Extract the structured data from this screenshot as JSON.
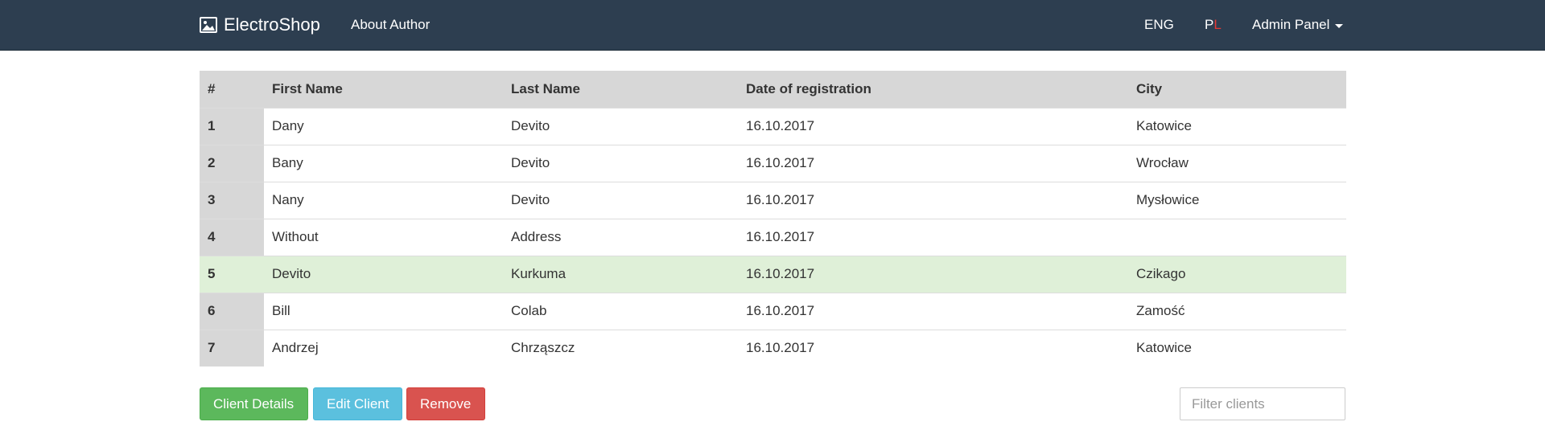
{
  "navbar": {
    "brand": "ElectroShop",
    "brand_icon": "image-icon",
    "about": "About Author",
    "lang_eng": "ENG",
    "lang_pl_p": "P",
    "lang_pl_l": "L",
    "admin": "Admin Panel",
    "bg_color": "#2d3e50",
    "accent_color": "#e53935"
  },
  "table": {
    "headers": [
      "#",
      "First Name",
      "Last Name",
      "Date of registration",
      "City"
    ],
    "rows": [
      [
        "1",
        "Dany",
        "Devito",
        "16.10.2017",
        "Katowice"
      ],
      [
        "2",
        "Bany",
        "Devito",
        "16.10.2017",
        "Wrocław"
      ],
      [
        "3",
        "Nany",
        "Devito",
        "16.10.2017",
        "Mysłowice"
      ],
      [
        "4",
        "Without",
        "Address",
        "16.10.2017",
        ""
      ],
      [
        "5",
        "Devito",
        "Kurkuma",
        "16.10.2017",
        "Czikago"
      ],
      [
        "6",
        "Bill",
        "Colab",
        "16.10.2017",
        "Zamość"
      ],
      [
        "7",
        "Andrzej",
        "Chrząszcz",
        "16.10.2017",
        "Katowice"
      ]
    ],
    "selected_row": 5,
    "selected_color": "#dff0d8"
  },
  "actions": {
    "details": "Client Details",
    "edit": "Edit Client",
    "remove": "Remove",
    "details_color": "#5cb85c",
    "edit_color": "#5bc0de",
    "remove_color": "#d9534f"
  },
  "filter": {
    "placeholder": "Filter clients",
    "value": ""
  }
}
